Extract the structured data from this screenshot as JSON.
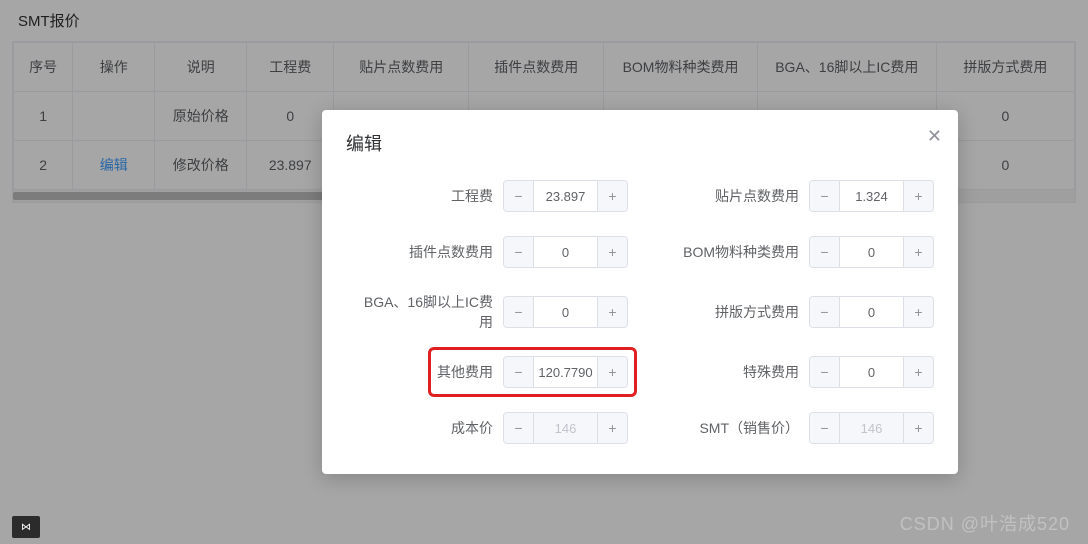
{
  "page_title": "SMT报价",
  "table": {
    "headers": [
      "序号",
      "操作",
      "说明",
      "工程费",
      "贴片点数费用",
      "插件点数费用",
      "BOM物料种类费用",
      "BGA、16脚以上IC费用",
      "拼版方式费用"
    ],
    "rows": [
      {
        "seq": "1",
        "op": "",
        "desc": "原始价格",
        "eng": "0",
        "last": "0"
      },
      {
        "seq": "2",
        "op": "编辑",
        "desc": "修改价格",
        "eng": "23.897",
        "last": "0"
      }
    ]
  },
  "dialog": {
    "title": "编辑",
    "fields": {
      "eng": {
        "label": "工程费",
        "value": "23.897"
      },
      "tiepian": {
        "label": "贴片点数费用",
        "value": "1.324"
      },
      "chajian": {
        "label": "插件点数费用",
        "value": "0"
      },
      "bom": {
        "label": "BOM物料种类费用",
        "value": "0"
      },
      "bga": {
        "label": "BGA、16脚以上IC费用",
        "value": "0"
      },
      "pinban": {
        "label": "拼版方式费用",
        "value": "0"
      },
      "other": {
        "label": "其他费用",
        "value": "120.7790"
      },
      "special": {
        "label": "特殊费用",
        "value": "0"
      },
      "cost": {
        "label": "成本价",
        "value": "146"
      },
      "smt": {
        "label": "SMT（销售价）",
        "value": "146"
      }
    }
  },
  "watermark": "CSDN @叶浩成520",
  "vs": "⋈"
}
